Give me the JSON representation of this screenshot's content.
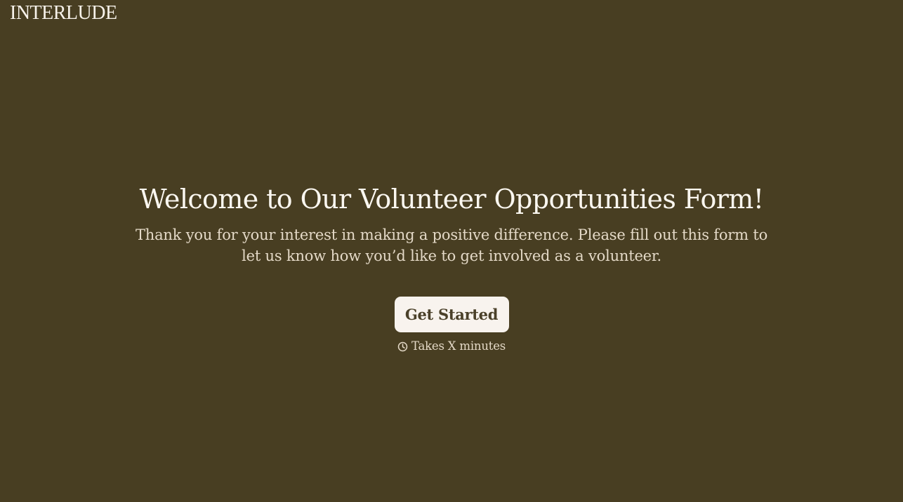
{
  "brand": {
    "name": "INTERLUDE"
  },
  "hero": {
    "title": "Welcome to Our Volunteer Opportunities Form!",
    "subtitle": "Thank you for your interest in making a positive difference. Please fill out this form to let us know how you’d like to get involved as a volunteer.",
    "cta_label": "Get Started",
    "duration_icon": "clock-icon",
    "duration_text": "Takes X minutes"
  },
  "colors": {
    "background": "#483e22",
    "title_text": "#fbf7f0",
    "body_text": "#e4d9c7",
    "button_bg": "#f8f3ee",
    "button_text": "#4a4029"
  }
}
